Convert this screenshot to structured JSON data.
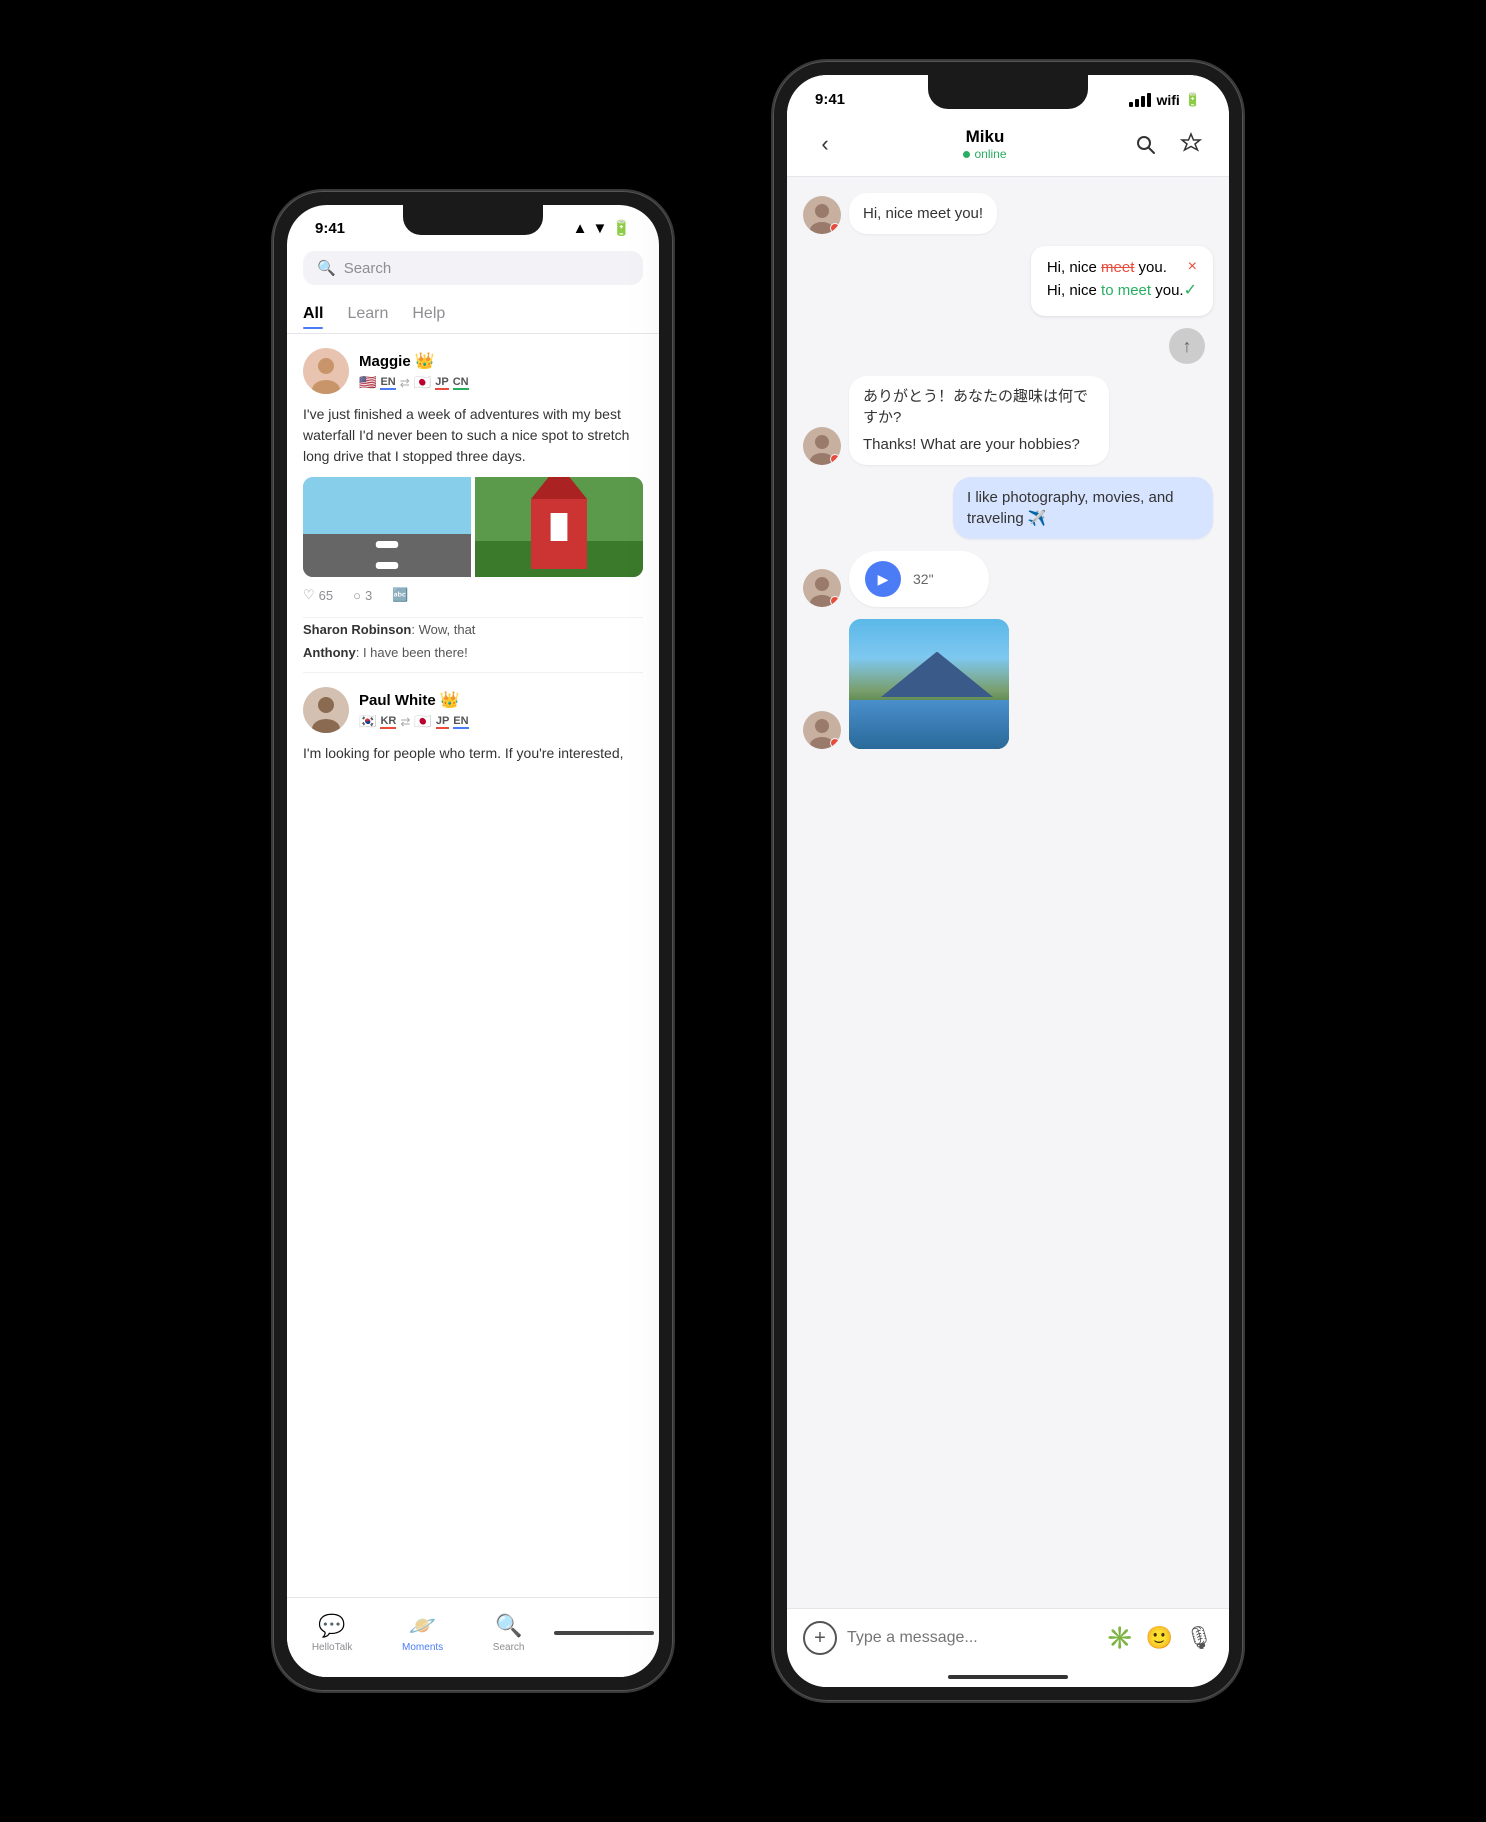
{
  "scene": {
    "background": "#000"
  },
  "back_phone": {
    "time": "9:41",
    "search_placeholder": "Search",
    "tabs": [
      "All",
      "Learn",
      "Help"
    ],
    "active_tab": "All",
    "post1": {
      "name": "Maggie",
      "has_crown": true,
      "lang_native": "EN",
      "lang_flag_native": "🇺🇸",
      "arrow": "⇄",
      "lang_learning": "JP",
      "lang_flag_learning": "🇯🇵",
      "lang_extra": "CN",
      "text": "I've just finished a week of adventures with my best waterfall I'd never been to such a nice spot to stretch long drive that I stopped three days.",
      "likes": "65",
      "comments": "3"
    },
    "post2": {
      "name": "Paul White",
      "has_crown": true,
      "lang_native": "KR",
      "lang_flag_native": "🇰🇷",
      "arrow": "⇄",
      "lang_learning": "JP",
      "lang_flag_learning": "🇯🇵",
      "lang_extra": "EN",
      "text": "I'm looking for people who term. If you're interested,"
    },
    "comments": [
      {
        "author": "Sharon Robinson",
        "text": "Wow, that"
      },
      {
        "author": "Anthony",
        "text": "I have been there!"
      }
    ],
    "nav": {
      "items": [
        {
          "label": "HelloTalk",
          "icon": "💬"
        },
        {
          "label": "Moments",
          "icon": "🪐",
          "active": true
        },
        {
          "label": "Search",
          "icon": "🔍"
        }
      ]
    }
  },
  "front_phone": {
    "time": "9:41",
    "contact_name": "Miku",
    "contact_status": "online",
    "messages": [
      {
        "type": "received",
        "text": "Hi, nice meet you!"
      },
      {
        "type": "correction",
        "wrong": "Hi, nice meet you.",
        "correct": "Hi, nice to meet you."
      },
      {
        "type": "received",
        "text_ja": "ありがとう！あなたの趣味は何ですか?",
        "text_en": "Thanks! What are your hobbies?"
      },
      {
        "type": "sent",
        "text": "I like photography, movies, and traveling ✈️"
      },
      {
        "type": "audio",
        "duration": "32\""
      },
      {
        "type": "image"
      }
    ],
    "input_placeholder": "Type a message..."
  }
}
